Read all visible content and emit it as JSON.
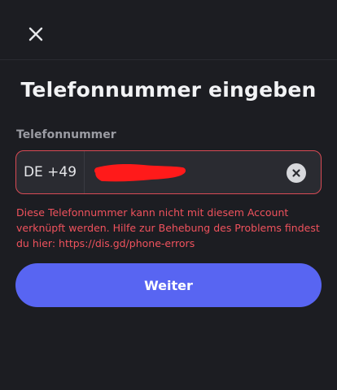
{
  "header": {
    "close_icon": "close-icon"
  },
  "page": {
    "title": "Telefonnummer eingeben"
  },
  "phone_field": {
    "label": "Telefonnummer",
    "country_code": "DE +49",
    "value": "",
    "value_redacted": true,
    "clear_icon": "clear-circle-x-icon"
  },
  "error": {
    "message": "Diese Telefonnummer kann nicht mit diesem Account verknüpft werden. Hilfe zur Behebung des Problems findest du hier: https://dis.gd/phone-errors"
  },
  "actions": {
    "continue_label": "Weiter"
  },
  "colors": {
    "background": "#1c1d22",
    "input_background": "#2a2b31",
    "error": "#f0525d",
    "primary_button": "#5865f2",
    "redaction": "#ff1a1a"
  }
}
